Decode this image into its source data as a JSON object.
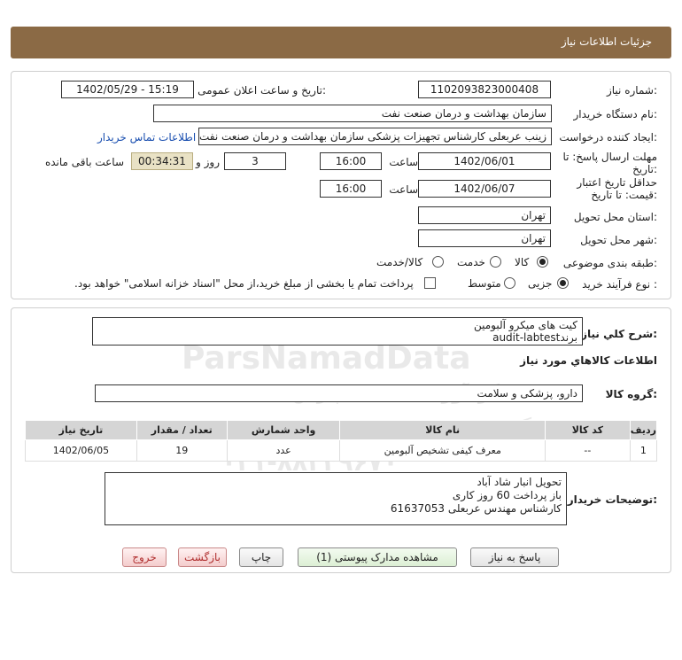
{
  "header": {
    "title": "جزئیات اطلاعات نیاز"
  },
  "labels": {
    "need_number": "شماره نیاز:",
    "announce_datetime": "تاریخ و ساعت اعلان عمومی:",
    "buyer_org": "نام دستگاه خریدار:",
    "requester": "ایجاد کننده درخواست:",
    "reply_deadline": "مهلت ارسال پاسخ: تا تاریخ:",
    "hour": "ساعت",
    "days_and": "روز و",
    "remaining": "ساعت باقی مانده",
    "price_validity": "حداقل تاریخ اعتبار قیمت: تا تاریخ:",
    "delivery_province": "استان محل تحویل:",
    "delivery_city": "شهر محل تحویل:",
    "subject_category": "طبقه بندی موضوعی:",
    "purchase_process": "نوع فرآیند خرید :",
    "general_desc": "شرح کلي نياز:",
    "goods_info": "اطلاعات کالاهاي مورد نياز",
    "goods_group": "گروه کالا:",
    "buyer_notes": "توضیحات خریدار:"
  },
  "fields": {
    "need_number": "1102093823000408",
    "announce_datetime": "1402/05/29 - 15:19",
    "buyer_org": "سازمان بهداشت و درمان صنعت نفت",
    "requester": "زینب عربعلی کارشناس تجهیزات پزشکی سازمان بهداشت و درمان صنعت نفت",
    "contact_link": "اطلاعات تماس خریدار",
    "reply_date": "1402/06/01",
    "reply_time": "16:00",
    "reply_days": "3",
    "remaining_time": "00:34:31",
    "validity_date": "1402/06/07",
    "validity_time": "16:00",
    "province": "تهران",
    "city": "تهران",
    "goods_group": "دارو، پزشکی و سلامت",
    "desc_line1": "کیت های میکرو آلبومین",
    "desc_line2": "برندaudit-labtest"
  },
  "category_options": [
    {
      "label": "کالا",
      "selected": true
    },
    {
      "label": "خدمت",
      "selected": false
    },
    {
      "label": "کالا/خدمت",
      "selected": false
    }
  ],
  "process_options": [
    {
      "label": "جزیی",
      "selected": true
    },
    {
      "label": "متوسط",
      "selected": false
    }
  ],
  "payment_note": "پرداخت تمام یا بخشی از مبلغ خرید،از محل \"اسناد خزانه اسلامی\" خواهد بود.",
  "table": {
    "headers": [
      "ردیف",
      "کد کالا",
      "نام کالا",
      "واحد شمارش",
      "تعداد / مقدار",
      "تاریخ نیاز"
    ],
    "rows": [
      [
        "1",
        "--",
        "معرف کیفی تشخیص آلبومین",
        "عدد",
        "19",
        "1402/06/05"
      ]
    ]
  },
  "notes": {
    "line1": "تحویل انبار شاد آباد",
    "line2": "باز پرداخت 60 روز کاری",
    "line3": "کارشناس  مهندس عربعلی 61637053"
  },
  "buttons": {
    "reply": "پاسخ به نیاز",
    "view_docs": "مشاهده مدارک پیوستی (1)",
    "print": "چاپ",
    "back": "بازگشت",
    "exit": "خروج"
  },
  "watermark": {
    "brand": "ParsNamadData",
    "line_fa1": "پایگاه اطلاع رسانی مناقصات و مزایده",
    "line_fa2": "گردآوری اطلاعات پارس نماد داده ها",
    "phone": "۰۲۱-۸۸۳۴۹۶۷۰"
  }
}
